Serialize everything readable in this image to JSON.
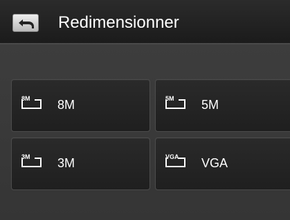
{
  "header": {
    "title": "Redimensionner",
    "back_icon": "back-arrow-icon"
  },
  "options": [
    {
      "label": "8M",
      "icon_text": "8M"
    },
    {
      "label": "5M",
      "icon_text": "5M"
    },
    {
      "label": "3M",
      "icon_text": "3M"
    },
    {
      "label": "VGA",
      "icon_text": "VGA"
    }
  ],
  "colors": {
    "background": "#3a3a3a",
    "header": "#1f1f1f",
    "tile": "#252525",
    "text": "#ffffff"
  }
}
